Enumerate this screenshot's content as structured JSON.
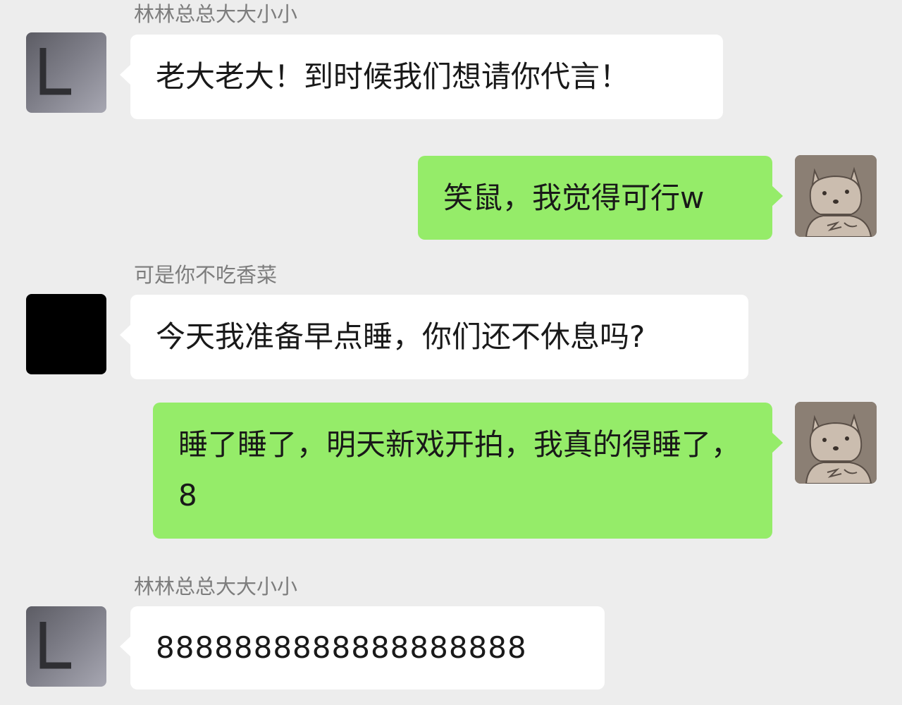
{
  "messages": [
    {
      "sender_name": "林林总总大大小小",
      "avatar": "letter-l-avatar",
      "side": "left",
      "text": "老大老大！到时候我们想请你代言！"
    },
    {
      "avatar": "bear-avatar",
      "side": "right",
      "text": "笑鼠，我觉得可行w"
    },
    {
      "sender_name": "可是你不吃香菜",
      "avatar": "black-avatar",
      "side": "left",
      "text": "今天我准备早点睡，你们还不休息吗?"
    },
    {
      "avatar": "bear-avatar",
      "side": "right",
      "text": "睡了睡了，明天新戏开拍，我真的得睡了，8"
    },
    {
      "sender_name": "林林总总大大小小",
      "avatar": "letter-l-avatar",
      "side": "left",
      "text": "8888888888888888888"
    }
  ],
  "colors": {
    "background": "#ededed",
    "incoming_bubble": "#ffffff",
    "outgoing_bubble": "#95ec69",
    "sender_name": "#7d7d7d",
    "text": "#191919"
  }
}
